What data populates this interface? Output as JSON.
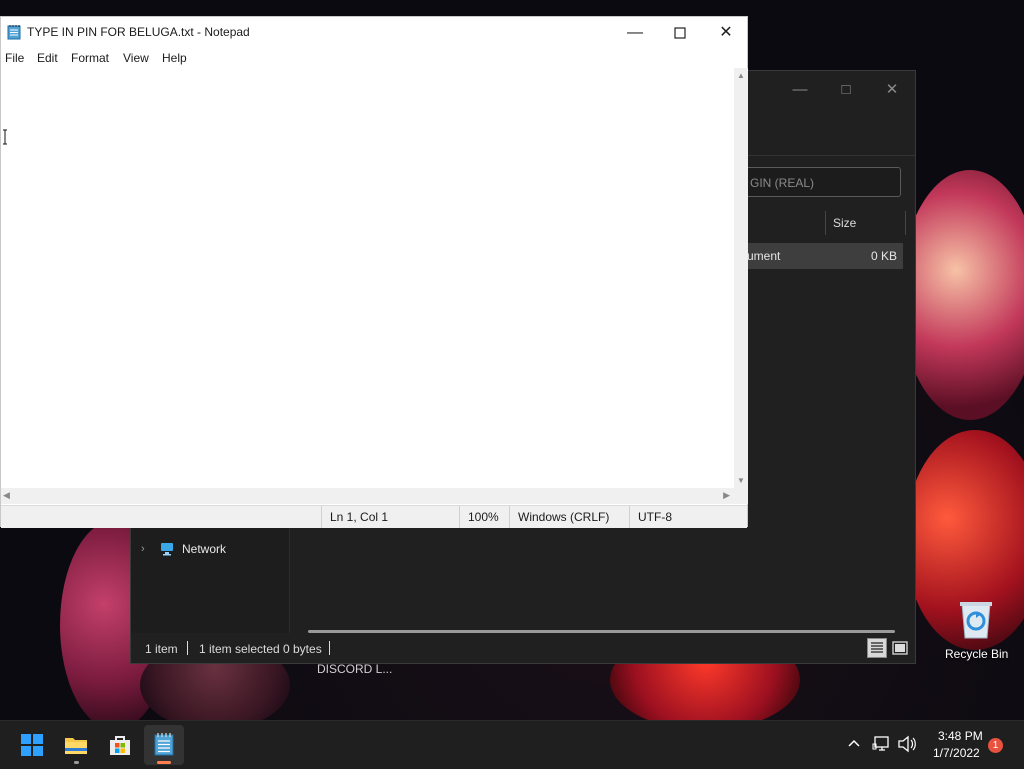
{
  "notepad": {
    "title": "TYPE IN PIN FOR BELUGA.txt - Notepad",
    "menu": [
      "File",
      "Edit",
      "Format",
      "View",
      "Help"
    ],
    "status": {
      "position": "Ln 1, Col 1",
      "zoom": "100%",
      "line_ending": "Windows (CRLF)",
      "encoding": "UTF-8"
    }
  },
  "explorer": {
    "search_placeholder": "GIN (REAL)",
    "column_size": "Size",
    "file_row": {
      "type": "cument",
      "size": "0 KB"
    },
    "nav_network": "Network",
    "status": {
      "items": "1 item",
      "selected": "1 item selected",
      "size": "0 bytes"
    }
  },
  "desktop": {
    "background_label": "DISCORD L...",
    "recycle_bin": "Recycle Bin"
  },
  "taskbar": {
    "time": "3:48 PM",
    "date": "1/7/2022",
    "notification_count": "1"
  }
}
